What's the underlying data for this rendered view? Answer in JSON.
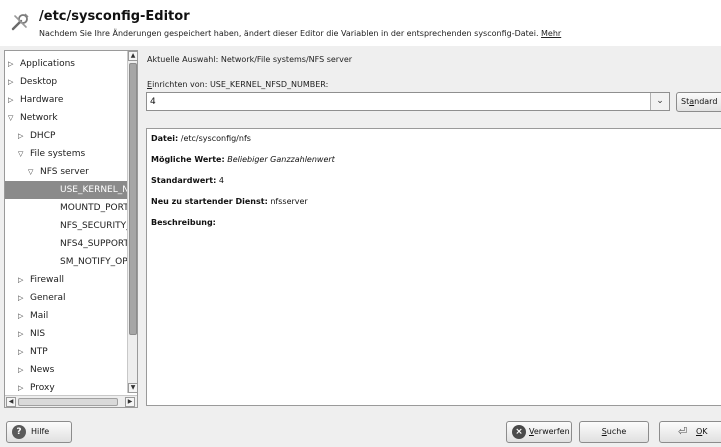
{
  "header": {
    "title": "/etc/sysconfig-Editor",
    "subtitle": "Nachdem Sie Ihre Änderungen gespeichert haben, ändert dieser Editor die Variablen in der entsprechenden sysconfig-Datei.",
    "more_link": "Mehr",
    "icon": "tools-icon"
  },
  "tree": {
    "items": [
      {
        "label": "Applications",
        "arrow": "▷"
      },
      {
        "label": "Desktop",
        "arrow": "▷"
      },
      {
        "label": "Hardware",
        "arrow": "▷"
      },
      {
        "label": "Network",
        "arrow": "▽"
      },
      {
        "label": "DHCP",
        "arrow": "▷"
      },
      {
        "label": "File systems",
        "arrow": "▽"
      },
      {
        "label": "NFS server",
        "arrow": "▽"
      },
      {
        "label": "USE_KERNEL_NFSD_NUMBER",
        "arrow": ""
      },
      {
        "label": "MOUNTD_PORT",
        "arrow": ""
      },
      {
        "label": "NFS_SECURITY_GSS",
        "arrow": ""
      },
      {
        "label": "NFS4_SUPPORT",
        "arrow": ""
      },
      {
        "label": "SM_NOTIFY_OPTIONS",
        "arrow": ""
      },
      {
        "label": "Firewall",
        "arrow": "▷"
      },
      {
        "label": "General",
        "arrow": "▷"
      },
      {
        "label": "Mail",
        "arrow": "▷"
      },
      {
        "label": "NIS",
        "arrow": "▷"
      },
      {
        "label": "NTP",
        "arrow": "▷"
      },
      {
        "label": "News",
        "arrow": "▷"
      },
      {
        "label": "Proxy",
        "arrow": "▷"
      }
    ],
    "scroll_up": "▲",
    "scroll_down": "▼",
    "scroll_left": "◀",
    "scroll_right": "▶"
  },
  "main": {
    "current_selection": "Aktuelle Auswahl: Network/File systems/NFS server",
    "setup_prefix": "E",
    "setup_rest": "inrichten von: USE_KERNEL_NFSD_NUMBER:",
    "value": "4",
    "combo_arrow": "⌄",
    "default_button_prefix": "St",
    "default_button_u": "a",
    "default_button_rest": "ndard"
  },
  "description": {
    "file_label": "Datei:",
    "file_value": "/etc/sysconfig/nfs",
    "possible_label": "Mögliche Werte:",
    "possible_value": "Beliebiger Ganzzahlenwert",
    "default_label": "Standardwert:",
    "default_value": "4",
    "restart_label": "Neu zu startender Dienst:",
    "restart_value": "nfsserver",
    "description_label": "Beschreibung:"
  },
  "buttons": {
    "help": "Hilfe",
    "discard_u": "V",
    "discard_rest": "erwerfen",
    "search_u": "S",
    "search_rest": "uche",
    "ok_u": "O",
    "ok_rest": "K"
  }
}
